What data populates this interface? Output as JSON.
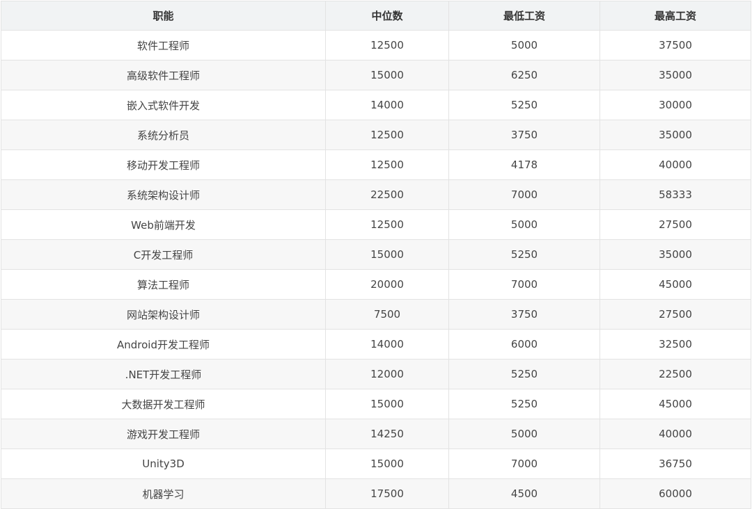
{
  "table": {
    "headers": [
      "职能",
      "中位数",
      "最低工资",
      "最高工资"
    ],
    "rows": [
      [
        "软件工程师",
        "12500",
        "5000",
        "37500"
      ],
      [
        "高级软件工程师",
        "15000",
        "6250",
        "35000"
      ],
      [
        "嵌入式软件开发",
        "14000",
        "5250",
        "30000"
      ],
      [
        "系统分析员",
        "12500",
        "3750",
        "35000"
      ],
      [
        "移动开发工程师",
        "12500",
        "4178",
        "40000"
      ],
      [
        "系统架构设计师",
        "22500",
        "7000",
        "58333"
      ],
      [
        "Web前端开发",
        "12500",
        "5000",
        "27500"
      ],
      [
        "C开发工程师",
        "15000",
        "5250",
        "35000"
      ],
      [
        "算法工程师",
        "20000",
        "7000",
        "45000"
      ],
      [
        "网站架构设计师",
        "7500",
        "3750",
        "27500"
      ],
      [
        "Android开发工程师",
        "14000",
        "6000",
        "32500"
      ],
      [
        ".NET开发工程师",
        "12000",
        "5250",
        "22500"
      ],
      [
        "大数据开发工程师",
        "15000",
        "5250",
        "45000"
      ],
      [
        "游戏开发工程师",
        "14250",
        "5000",
        "40000"
      ],
      [
        "Unity3D",
        "15000",
        "7000",
        "36750"
      ],
      [
        "机器学习",
        "17500",
        "4500",
        "60000"
      ]
    ]
  }
}
